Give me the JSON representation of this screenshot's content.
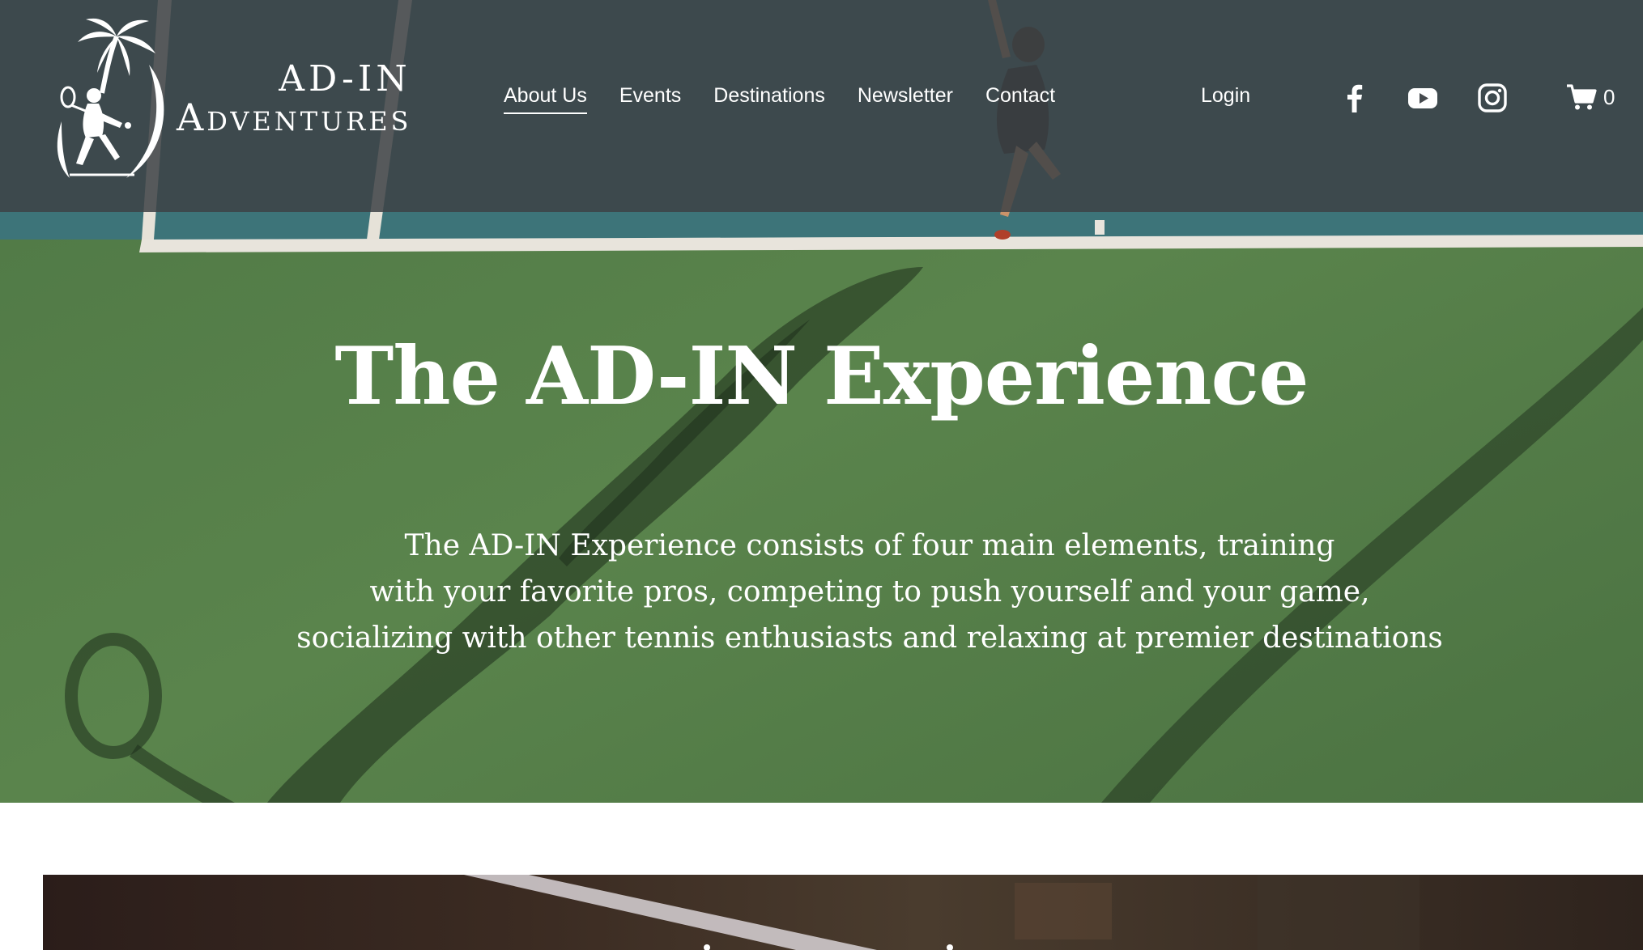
{
  "brand": {
    "line1": "AD-IN",
    "line2": "Adventures"
  },
  "nav": {
    "items": [
      {
        "label": "About Us",
        "active": true
      },
      {
        "label": "Events",
        "active": false
      },
      {
        "label": "Destinations",
        "active": false
      },
      {
        "label": "Newsletter",
        "active": false
      },
      {
        "label": "Contact",
        "active": false
      }
    ],
    "login_label": "Login"
  },
  "social": {
    "icons": [
      "facebook-icon",
      "youtube-icon",
      "instagram-icon"
    ]
  },
  "cart": {
    "icon": "cart-icon",
    "count": "0"
  },
  "hero": {
    "title": "The AD-IN Experience",
    "body_lines": [
      "The AD-IN Experience consists of four main elements, training",
      "with your favorite pros, competing to push yourself and your game,",
      "socializing with other tennis enthusiasts and relaxing at premier destinations"
    ]
  },
  "colors": {
    "header_overlay": "#3e4246",
    "court_green": "#557e48",
    "court_blue": "#3f7f86",
    "text": "#ffffff"
  }
}
